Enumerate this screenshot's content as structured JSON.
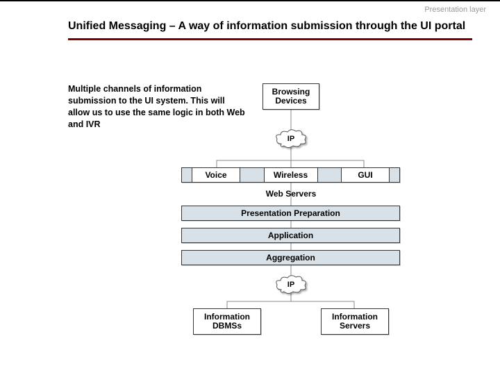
{
  "header": {
    "layer_label": "Presentation layer",
    "title": "Unified Messaging – A way of information submission through the UI portal"
  },
  "description": "Multiple channels of information submission to the UI system. This will allow us to use the same logic in both Web and IVR",
  "nodes": {
    "browsing_devices": "Browsing Devices",
    "ip_top": "IP",
    "voice": "Voice",
    "wireless": "Wireless",
    "gui": "GUI",
    "web_servers": "Web Servers",
    "presentation_preparation": "Presentation Preparation",
    "application": "Application",
    "aggregation": "Aggregation",
    "ip_bottom": "IP",
    "information_dbmss": "Information DBMSs",
    "information_servers": "Information Servers"
  }
}
